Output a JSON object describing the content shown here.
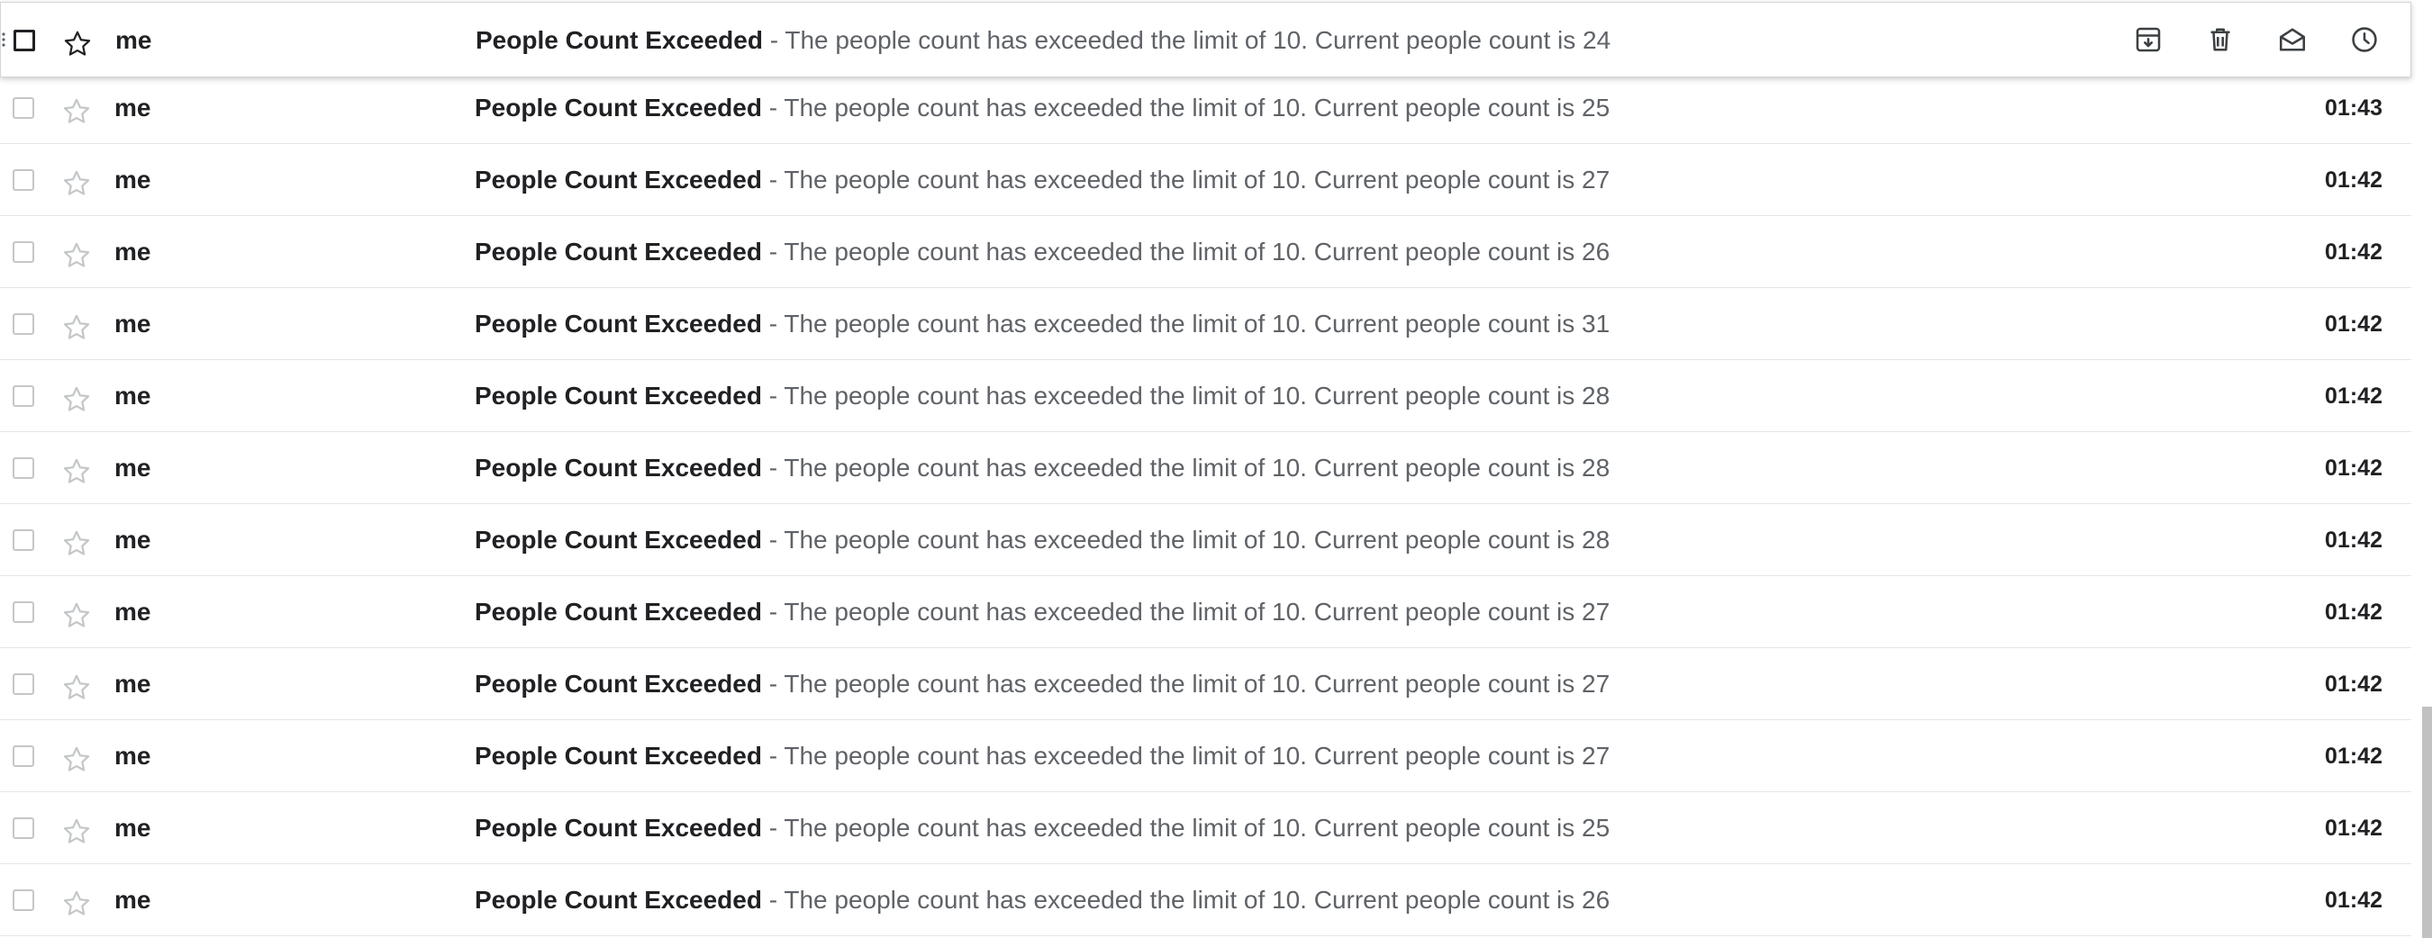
{
  "hover_actions": {
    "archive": "archive-icon",
    "delete": "trash-icon",
    "mark_read": "mail-open-icon",
    "snooze": "clock-icon"
  },
  "emails": [
    {
      "sender": "me",
      "subject": "People Count Exceeded",
      "separator": "-",
      "snippet": "The people count has exceeded the limit of 10. Current people count is 24",
      "time": ""
    },
    {
      "sender": "me",
      "subject": "People Count Exceeded",
      "separator": "-",
      "snippet": "The people count has exceeded the limit of 10. Current people count is 25",
      "time": "01:43"
    },
    {
      "sender": "me",
      "subject": "People Count Exceeded",
      "separator": "-",
      "snippet": "The people count has exceeded the limit of 10. Current people count is 27",
      "time": "01:42"
    },
    {
      "sender": "me",
      "subject": "People Count Exceeded",
      "separator": "-",
      "snippet": "The people count has exceeded the limit of 10. Current people count is 26",
      "time": "01:42"
    },
    {
      "sender": "me",
      "subject": "People Count Exceeded",
      "separator": "-",
      "snippet": "The people count has exceeded the limit of 10. Current people count is 31",
      "time": "01:42"
    },
    {
      "sender": "me",
      "subject": "People Count Exceeded",
      "separator": "-",
      "snippet": "The people count has exceeded the limit of 10. Current people count is 28",
      "time": "01:42"
    },
    {
      "sender": "me",
      "subject": "People Count Exceeded",
      "separator": "-",
      "snippet": "The people count has exceeded the limit of 10. Current people count is 28",
      "time": "01:42"
    },
    {
      "sender": "me",
      "subject": "People Count Exceeded",
      "separator": "-",
      "snippet": "The people count has exceeded the limit of 10. Current people count is 28",
      "time": "01:42"
    },
    {
      "sender": "me",
      "subject": "People Count Exceeded",
      "separator": "-",
      "snippet": "The people count has exceeded the limit of 10. Current people count is 27",
      "time": "01:42"
    },
    {
      "sender": "me",
      "subject": "People Count Exceeded",
      "separator": "-",
      "snippet": "The people count has exceeded the limit of 10. Current people count is 27",
      "time": "01:42"
    },
    {
      "sender": "me",
      "subject": "People Count Exceeded",
      "separator": "-",
      "snippet": "The people count has exceeded the limit of 10. Current people count is 27",
      "time": "01:42"
    },
    {
      "sender": "me",
      "subject": "People Count Exceeded",
      "separator": "-",
      "snippet": "The people count has exceeded the limit of 10. Current people count is 25",
      "time": "01:42"
    },
    {
      "sender": "me",
      "subject": "People Count Exceeded",
      "separator": "-",
      "snippet": "The people count has exceeded the limit of 10. Current people count is 26",
      "time": "01:42"
    }
  ],
  "colors": {
    "text_primary": "#202124",
    "text_secondary": "#5f6368",
    "divider": "#e3e5e8",
    "checkbox_border": "#c4c7c9",
    "scrollbar": "#c1c1c1"
  }
}
